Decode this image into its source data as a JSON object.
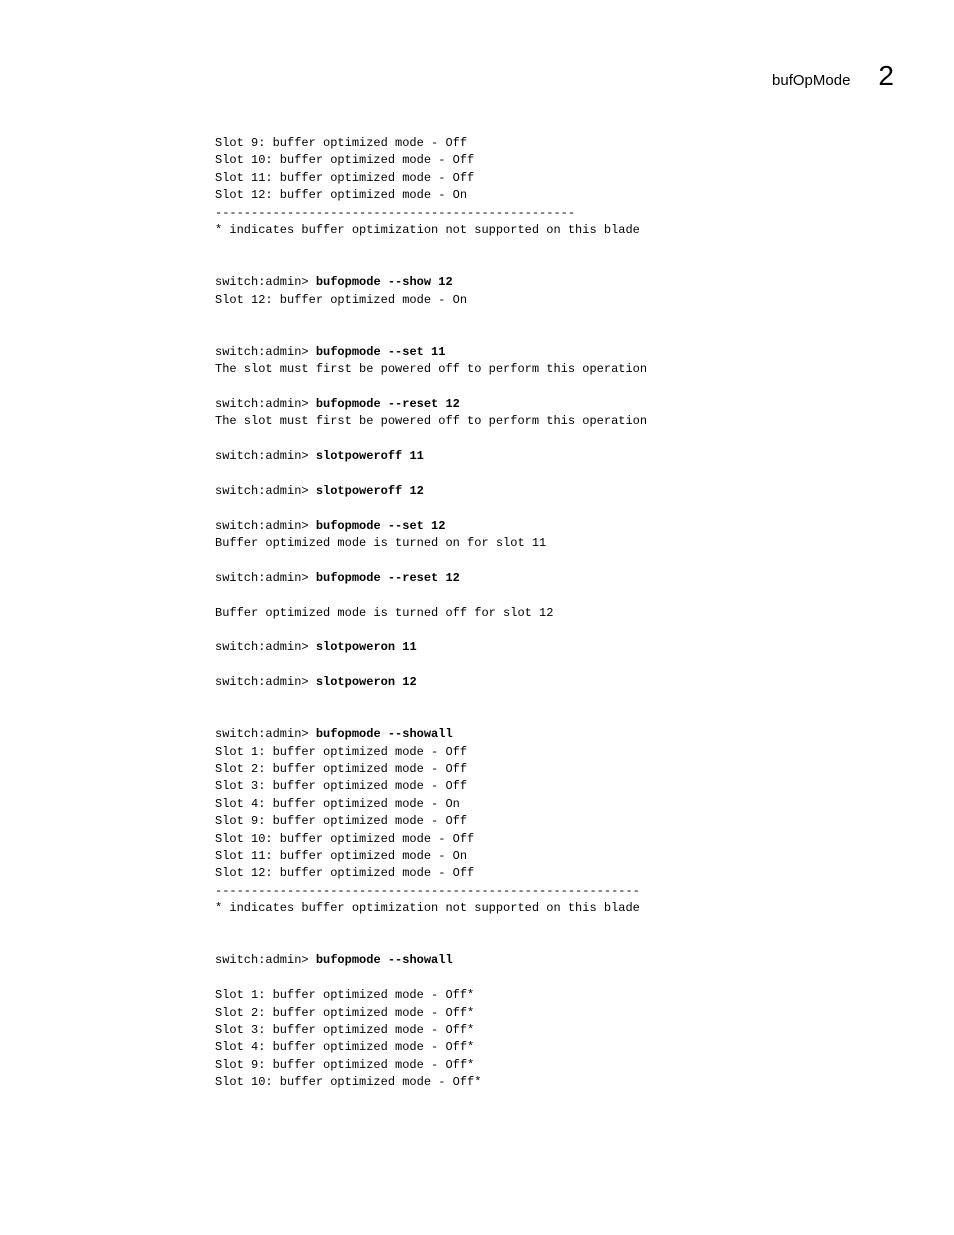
{
  "header": {
    "title": "bufOpMode",
    "number": "2"
  },
  "lines": [
    {
      "text": "Slot 9: buffer optimized mode - Off"
    },
    {
      "text": "Slot 10: buffer optimized mode - Off"
    },
    {
      "text": "Slot 11: buffer optimized mode - Off"
    },
    {
      "text": "Slot 12: buffer optimized mode - On"
    },
    {
      "text": "--------------------------------------------------"
    },
    {
      "text": "* indicates buffer optimization not supported on this blade"
    },
    {
      "text": ""
    },
    {
      "text": ""
    },
    {
      "prompt": "switch:admin> ",
      "cmd": "bufopmode --show 12"
    },
    {
      "text": "Slot 12: buffer optimized mode - On"
    },
    {
      "text": ""
    },
    {
      "text": ""
    },
    {
      "prompt": "switch:admin> ",
      "cmd": "bufopmode --set 11"
    },
    {
      "text": "The slot must first be powered off to perform this operation"
    },
    {
      "text": ""
    },
    {
      "prompt": "switch:admin> ",
      "cmd": "bufopmode --reset 12"
    },
    {
      "text": "The slot must first be powered off to perform this operation"
    },
    {
      "text": ""
    },
    {
      "prompt": "switch:admin> ",
      "cmd": "slotpoweroff 11"
    },
    {
      "text": ""
    },
    {
      "prompt": "switch:admin> ",
      "cmd": "slotpoweroff 12"
    },
    {
      "text": ""
    },
    {
      "prompt": "switch:admin> ",
      "cmd": "bufopmode --set 12"
    },
    {
      "text": "Buffer optimized mode is turned on for slot 11"
    },
    {
      "text": ""
    },
    {
      "prompt": "switch:admin> ",
      "cmd": "bufopmode --reset 12"
    },
    {
      "text": ""
    },
    {
      "text": "Buffer optimized mode is turned off for slot 12"
    },
    {
      "text": ""
    },
    {
      "prompt": "switch:admin> ",
      "cmd": "slotpoweron 11"
    },
    {
      "text": ""
    },
    {
      "prompt": "switch:admin> ",
      "cmd": "slotpoweron 12"
    },
    {
      "text": ""
    },
    {
      "text": ""
    },
    {
      "prompt": "switch:admin> ",
      "cmd": "bufopmode --showall"
    },
    {
      "text": "Slot 1: buffer optimized mode - Off"
    },
    {
      "text": "Slot 2: buffer optimized mode - Off"
    },
    {
      "text": "Slot 3: buffer optimized mode - Off"
    },
    {
      "text": "Slot 4: buffer optimized mode - On"
    },
    {
      "text": "Slot 9: buffer optimized mode - Off"
    },
    {
      "text": "Slot 10: buffer optimized mode - Off"
    },
    {
      "text": "Slot 11: buffer optimized mode - On"
    },
    {
      "text": "Slot 12: buffer optimized mode - Off"
    },
    {
      "text": "-----------------------------------------------------------"
    },
    {
      "text": "* indicates buffer optimization not supported on this blade"
    },
    {
      "text": ""
    },
    {
      "text": ""
    },
    {
      "prompt": "switch:admin> ",
      "cmd": "bufopmode --showall"
    },
    {
      "text": ""
    },
    {
      "text": "Slot 1: buffer optimized mode - Off*"
    },
    {
      "text": "Slot 2: buffer optimized mode - Off*"
    },
    {
      "text": "Slot 3: buffer optimized mode - Off*"
    },
    {
      "text": "Slot 4: buffer optimized mode - Off*"
    },
    {
      "text": "Slot 9: buffer optimized mode - Off*"
    },
    {
      "text": "Slot 10: buffer optimized mode - Off*"
    }
  ]
}
